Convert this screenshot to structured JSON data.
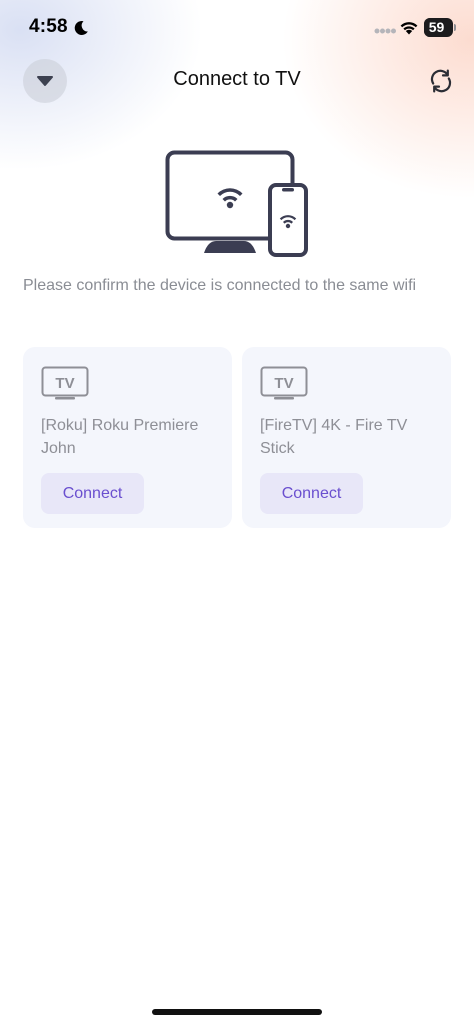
{
  "status_bar": {
    "time": "4:58",
    "battery": "59",
    "battery_level": 0.59
  },
  "header": {
    "title": "Connect to TV",
    "collapse_icon": "triangle-down-icon",
    "refresh_icon": "refresh-icon"
  },
  "illustration": {
    "icon": "tv-phone-wifi-icon"
  },
  "instruction": "Please confirm the device is connected to the same wifi",
  "devices": [
    {
      "badge": "TV",
      "name": "[Roku] Roku Premiere John",
      "action": "Connect"
    },
    {
      "badge": "TV",
      "name": "[FireTV] 4K - Fire TV Stick",
      "action": "Connect"
    }
  ],
  "colors": {
    "accent": "#6a4fcf",
    "button_bg": "#e8e7f8",
    "card_bg": "#f4f6fc",
    "muted_text": "#8a8d94"
  }
}
